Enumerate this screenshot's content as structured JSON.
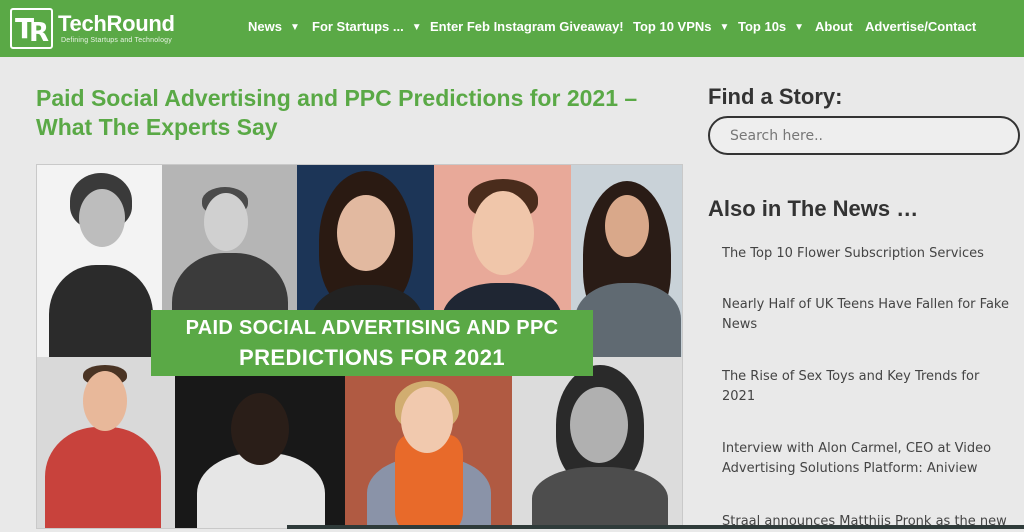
{
  "brand": {
    "name": "TechRound",
    "tagline": "Defining Startups and Technology",
    "mark": "TR"
  },
  "nav": {
    "items": [
      {
        "label": "News",
        "dropdown": true
      },
      {
        "label": "For Startups ...",
        "dropdown": true
      },
      {
        "label": "Enter Feb Instagram Giveaway!",
        "dropdown": false
      },
      {
        "label": "Top 10 VPNs",
        "dropdown": true
      },
      {
        "label": "Top 10s",
        "dropdown": true
      },
      {
        "label": "About",
        "dropdown": false
      },
      {
        "label": "Advertise/Contact",
        "dropdown": false
      }
    ]
  },
  "article": {
    "title": "Paid Social Advertising and PPC Predictions for 2021 – What The Experts Say",
    "hero_banner_line1": "PAID SOCIAL ADVERTISING AND PPC",
    "hero_banner_line2": "PREDICTIONS FOR 2021"
  },
  "sidebar": {
    "find_heading": "Find a Story:",
    "search_placeholder": "Search here..",
    "news_heading": "Also in The News …",
    "news": [
      "The Top 10 Flower Subscription Services",
      "Nearly Half of UK Teens Have Fallen for Fake News",
      "The Rise of Sex Toys and Key Trends for 2021",
      "Interview with Alon Carmel, CEO at Video Advertising Solutions Platform: Aniview",
      "Straal announces Matthijs Pronk as the new"
    ]
  },
  "colors": {
    "brand_green": "#5aa946",
    "page_bg": "#e9e9e9",
    "heading_dark": "#333333"
  }
}
